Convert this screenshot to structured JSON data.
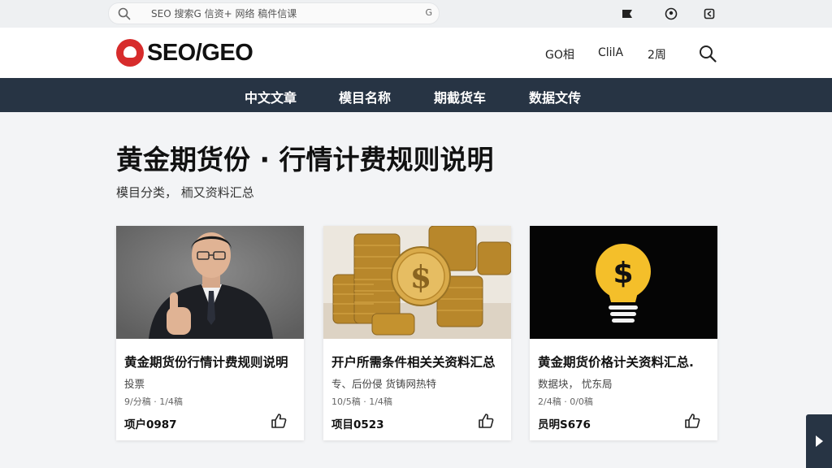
{
  "top_bar": {
    "search_text": "SEO  搜索G  信资+ 网络 稿件信课",
    "search_suffix": "G"
  },
  "header": {
    "logo_text": "SEO/GEO",
    "links": [
      "GO相",
      "ClilA",
      "2周"
    ]
  },
  "nav": {
    "items": [
      "中文文章",
      "模目名称",
      "期截货车",
      "数据文传"
    ]
  },
  "main": {
    "title": "黄金期货份 · 行情计费规则说明",
    "subtitle": "模目分类， 栭又资料汇总"
  },
  "cards": [
    {
      "title": "黄金期货份行情计费规则说明",
      "tags": "投票",
      "date": "9/分稿 · 1/4稿",
      "id": "项户0987",
      "image": "businessman-thumbs-up"
    },
    {
      "title": "开户所需条件相关关资料汇总",
      "tags": "专、后份侵  货铸网热特",
      "date": "10/5稿 · 1/4稿",
      "id": "项目0523",
      "image": "gold-coin-stacks"
    },
    {
      "title": "黄金期货价格计关资料汇总.",
      "tags": "数据块，  忧东局",
      "date": "2/4稿 · 0/0稿",
      "id": "员明S676",
      "image": "dollar-lightbulb"
    }
  ],
  "colors": {
    "nav_bg": "#273444",
    "logo_red": "#d72c2c",
    "page_bg": "#f3f4f6"
  }
}
